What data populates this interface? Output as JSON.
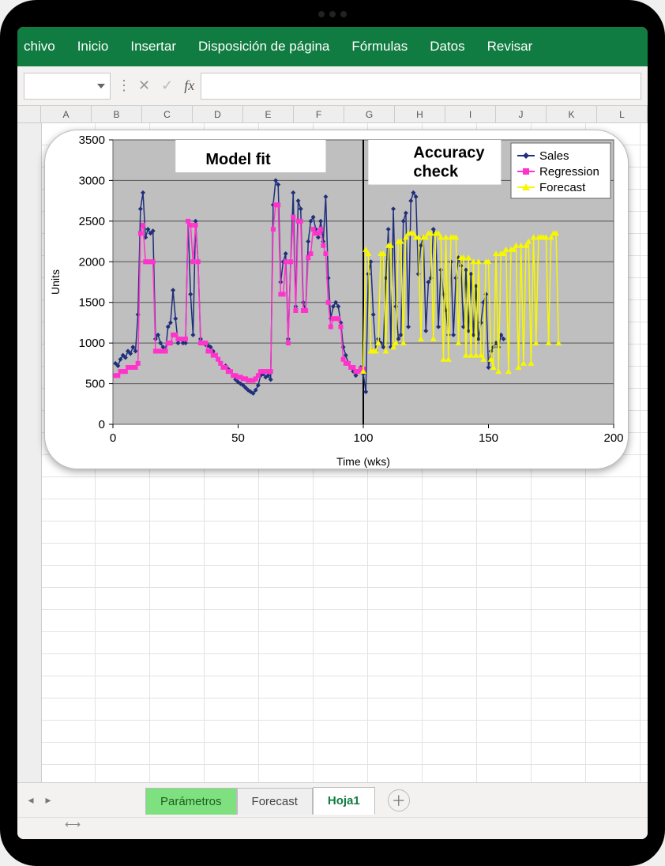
{
  "ribbon": {
    "tabs": [
      "chivo",
      "Inicio",
      "Insertar",
      "Disposición de página",
      "Fórmulas",
      "Datos",
      "Revisar"
    ]
  },
  "formula_bar": {
    "name_box": "",
    "fx_label": "fx",
    "formula": ""
  },
  "columns": [
    "A",
    "B",
    "C",
    "D",
    "E",
    "F",
    "G",
    "H",
    "I",
    "J",
    "K",
    "L"
  ],
  "sheet_tabs": {
    "items": [
      "Parámetros",
      "Forecast",
      "Hoja1"
    ],
    "active_index": 2
  },
  "chart_data": {
    "type": "line",
    "xlabel": "Time (wks)",
    "ylabel": "Units",
    "xlim": [
      0,
      200
    ],
    "ylim": [
      0,
      3500
    ],
    "xticks": [
      0,
      50,
      100,
      150,
      200
    ],
    "yticks": [
      0,
      500,
      1000,
      1500,
      2000,
      2500,
      3000,
      3500
    ],
    "annotations": [
      {
        "text": "Model fit",
        "x": 50,
        "y": 3250
      },
      {
        "text": "Accuracy check",
        "x": 120,
        "y": 3250
      }
    ],
    "vline_x": 100,
    "legend": [
      "Sales",
      "Regression",
      "Forecast"
    ],
    "series": [
      {
        "name": "Sales",
        "color": "#1f2f7a",
        "marker": "diamond",
        "x": [
          1,
          2,
          3,
          4,
          5,
          6,
          7,
          8,
          9,
          10,
          11,
          12,
          13,
          14,
          15,
          16,
          17,
          18,
          19,
          20,
          21,
          22,
          23,
          24,
          25,
          26,
          27,
          28,
          29,
          30,
          31,
          32,
          33,
          34,
          35,
          36,
          37,
          38,
          39,
          40,
          41,
          42,
          43,
          44,
          45,
          46,
          47,
          48,
          49,
          50,
          51,
          52,
          53,
          54,
          55,
          56,
          57,
          58,
          59,
          60,
          61,
          62,
          63,
          64,
          65,
          66,
          67,
          68,
          69,
          70,
          71,
          72,
          73,
          74,
          75,
          76,
          77,
          78,
          79,
          80,
          81,
          82,
          83,
          84,
          85,
          86,
          87,
          88,
          89,
          90,
          91,
          92,
          93,
          94,
          95,
          96,
          97,
          98,
          99,
          100,
          101,
          102,
          103,
          104,
          105,
          106,
          107,
          108,
          109,
          110,
          111,
          112,
          113,
          114,
          115,
          116,
          117,
          118,
          119,
          120,
          121,
          122,
          123,
          124,
          125,
          126,
          127,
          128,
          129,
          130,
          131,
          132,
          133,
          134,
          135,
          136,
          137,
          138,
          139,
          140,
          141,
          142,
          143,
          144,
          145,
          146,
          147,
          148,
          149,
          150,
          151,
          152,
          153,
          154,
          155,
          156
        ],
        "values": [
          750,
          720,
          800,
          850,
          820,
          900,
          870,
          950,
          900,
          1350,
          2650,
          2850,
          2300,
          2400,
          2350,
          2380,
          1050,
          1100,
          1000,
          950,
          900,
          1200,
          1250,
          1650,
          1300,
          1000,
          1050,
          1000,
          1000,
          2500,
          1600,
          1100,
          2500,
          2000,
          1050,
          1000,
          980,
          970,
          950,
          900,
          850,
          800,
          750,
          700,
          720,
          680,
          650,
          600,
          550,
          520,
          500,
          480,
          450,
          420,
          400,
          380,
          420,
          480,
          600,
          620,
          580,
          600,
          550,
          2700,
          3000,
          2950,
          1750,
          2000,
          2100,
          1050,
          2000,
          2850,
          1450,
          2750,
          2650,
          1500,
          1400,
          2250,
          2500,
          2550,
          2400,
          2300,
          2500,
          2250,
          2800,
          1800,
          1300,
          1450,
          1500,
          1450,
          1250,
          950,
          850,
          750,
          700,
          650,
          600,
          650,
          700,
          620,
          400,
          1850,
          2000,
          1350,
          900,
          1050,
          1000,
          950,
          1800,
          2400,
          950,
          2650,
          1450,
          1050,
          1100,
          2500,
          2600,
          1200,
          2750,
          2850,
          2800,
          1850,
          2200,
          2300,
          1150,
          1750,
          1800,
          2400,
          2350,
          1200,
          1900,
          1600,
          1400,
          1100,
          2000,
          1100,
          1800,
          2050,
          1950,
          1200,
          1900,
          1150,
          1850,
          1100,
          1700,
          1050,
          1250,
          1500,
          1600,
          700,
          900,
          950,
          1000,
          950,
          1100,
          1050
        ]
      },
      {
        "name": "Regression",
        "color": "#ff33cc",
        "marker": "square",
        "x": [
          1,
          2,
          3,
          4,
          5,
          6,
          7,
          8,
          9,
          10,
          11,
          12,
          13,
          14,
          15,
          16,
          17,
          18,
          19,
          20,
          21,
          22,
          23,
          24,
          25,
          26,
          27,
          28,
          29,
          30,
          31,
          32,
          33,
          34,
          35,
          36,
          37,
          38,
          39,
          40,
          41,
          42,
          43,
          44,
          45,
          46,
          47,
          48,
          49,
          50,
          51,
          52,
          53,
          54,
          55,
          56,
          57,
          58,
          59,
          60,
          61,
          62,
          63,
          64,
          65,
          66,
          67,
          68,
          69,
          70,
          71,
          72,
          73,
          74,
          75,
          76,
          77,
          78,
          79,
          80,
          81,
          82,
          83,
          84,
          85,
          86,
          87,
          88,
          89,
          90,
          91,
          92,
          93,
          94,
          95,
          96,
          97,
          98,
          99,
          100
        ],
        "values": [
          600,
          600,
          650,
          650,
          650,
          700,
          700,
          700,
          700,
          750,
          2350,
          2450,
          2000,
          2000,
          2000,
          2000,
          900,
          900,
          900,
          900,
          900,
          1000,
          1000,
          1100,
          1100,
          1050,
          1050,
          1050,
          1050,
          2500,
          2450,
          2000,
          2450,
          2000,
          1000,
          1000,
          1000,
          900,
          900,
          850,
          850,
          800,
          750,
          700,
          700,
          650,
          650,
          600,
          600,
          580,
          580,
          560,
          560,
          540,
          540,
          540,
          560,
          600,
          650,
          650,
          650,
          650,
          650,
          2400,
          2700,
          2700,
          1600,
          1600,
          2000,
          1000,
          2000,
          2550,
          1400,
          2500,
          2500,
          1400,
          1400,
          2050,
          2100,
          2400,
          2350,
          2350,
          2400,
          2200,
          2100,
          1500,
          1200,
          1300,
          1300,
          1300,
          1200,
          800,
          750,
          750,
          700,
          700,
          650,
          650,
          680,
          680
        ]
      },
      {
        "name": "Forecast",
        "color": "#f7f700",
        "marker": "triangle",
        "x": [
          100,
          101,
          102,
          103,
          104,
          105,
          106,
          107,
          108,
          109,
          110,
          111,
          112,
          113,
          114,
          115,
          116,
          117,
          118,
          119,
          120,
          121,
          122,
          123,
          124,
          125,
          126,
          127,
          128,
          129,
          130,
          131,
          132,
          133,
          134,
          135,
          136,
          137,
          138,
          139,
          140,
          141,
          142,
          143,
          144,
          145,
          146,
          147,
          148,
          149,
          150,
          151,
          152,
          153,
          154,
          155,
          156,
          157,
          158,
          159,
          160,
          161,
          162,
          163,
          164,
          165,
          166,
          167,
          168,
          169,
          170,
          171,
          172,
          173,
          174,
          175,
          176,
          177,
          178
        ],
        "values": [
          650,
          2150,
          2100,
          900,
          900,
          900,
          1000,
          2100,
          2100,
          900,
          2200,
          2200,
          950,
          1000,
          2250,
          2250,
          1000,
          2300,
          2350,
          2350,
          2350,
          2300,
          2300,
          1050,
          2300,
          2300,
          2350,
          2350,
          1050,
          2350,
          2350,
          2300,
          800,
          2300,
          800,
          2300,
          2300,
          2300,
          1000,
          2050,
          2050,
          850,
          2050,
          850,
          2000,
          850,
          2000,
          850,
          800,
          2000,
          2000,
          800,
          700,
          2100,
          650,
          2100,
          2100,
          2150,
          650,
          2150,
          2150,
          2200,
          700,
          2200,
          750,
          2200,
          2250,
          750,
          2300,
          1000,
          2300,
          2300,
          2300,
          2300,
          1000,
          2300,
          2350,
          2350,
          1000
        ]
      }
    ]
  }
}
